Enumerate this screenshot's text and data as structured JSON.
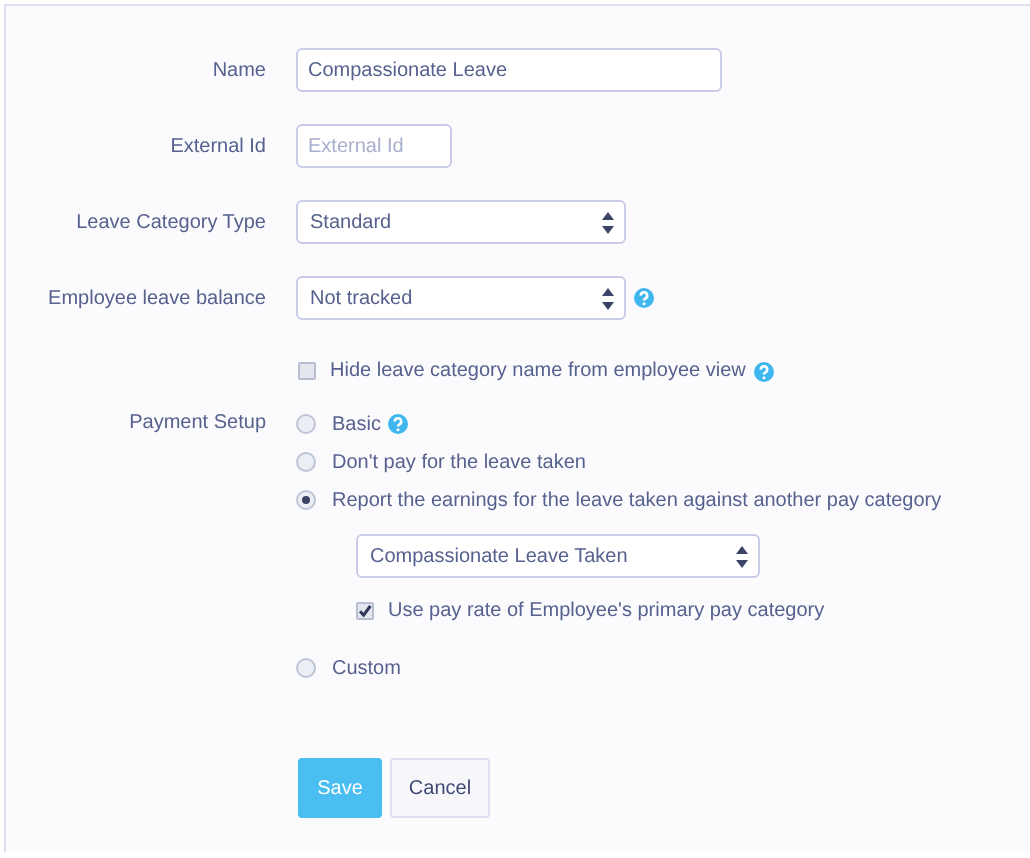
{
  "fields": [
    {
      "kind": "text",
      "label": "Name",
      "value": "Compassionate Leave"
    },
    {
      "kind": "text",
      "label": "External Id",
      "placeholder": "External Id"
    },
    {
      "kind": "select",
      "label": "Leave Category Type",
      "value": "Standard"
    },
    {
      "kind": "select",
      "label": "Employee leave balance",
      "value": "Not tracked",
      "help": true
    }
  ],
  "hide_name_checkbox": {
    "label": "Hide leave category name from employee view",
    "checked": false,
    "help": true
  },
  "payment_setup": {
    "label": "Payment Setup",
    "options": [
      {
        "label": "Basic",
        "selected": false,
        "help": true
      },
      {
        "label": "Don't pay for the leave taken",
        "selected": false
      },
      {
        "label": "Report the earnings for the leave taken against another pay category",
        "selected": true,
        "pay_category": "Compassionate Leave Taken",
        "use_primary_rate": {
          "label": "Use pay rate of Employee's primary pay category",
          "checked": true
        }
      },
      {
        "label": "Custom",
        "selected": false
      }
    ]
  },
  "buttons": [
    {
      "label": "Save",
      "kind": "primary"
    },
    {
      "label": "Cancel",
      "kind": "default"
    }
  ]
}
